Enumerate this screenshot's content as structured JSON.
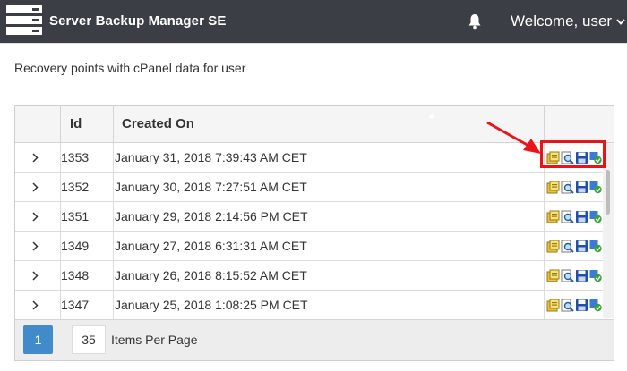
{
  "header": {
    "app_title": "Server Backup Manager SE",
    "welcome": "Welcome, user",
    "background": "#3b3f45"
  },
  "page": {
    "heading": "Recovery points with cPanel data for user"
  },
  "grid": {
    "columns": [
      {
        "key": "expand",
        "label": ""
      },
      {
        "key": "id",
        "label": "Id"
      },
      {
        "key": "created",
        "label": "Created On"
      },
      {
        "key": "actions",
        "label": ""
      }
    ],
    "rows": [
      {
        "id": "1353",
        "created": "January 31, 2018 7:39:43 AM CET"
      },
      {
        "id": "1352",
        "created": "January 30, 2018 7:27:51 AM CET"
      },
      {
        "id": "1351",
        "created": "January 29, 2018 2:14:56 PM CET"
      },
      {
        "id": "1349",
        "created": "January 27, 2018 6:31:31 AM CET"
      },
      {
        "id": "1348",
        "created": "January 26, 2018 8:15:52 AM CET"
      },
      {
        "id": "1347",
        "created": "January 25, 2018 1:08:25 PM CET"
      }
    ],
    "row_action_icons": [
      "browse-files-icon",
      "search-icon",
      "save-icon",
      "restore-icon"
    ]
  },
  "pager": {
    "current_page": "1",
    "items_per_page": "35",
    "items_per_page_label": "Items Per Page",
    "accent": "#428bca"
  },
  "annotation": {
    "highlight_color": "#e8141a"
  }
}
